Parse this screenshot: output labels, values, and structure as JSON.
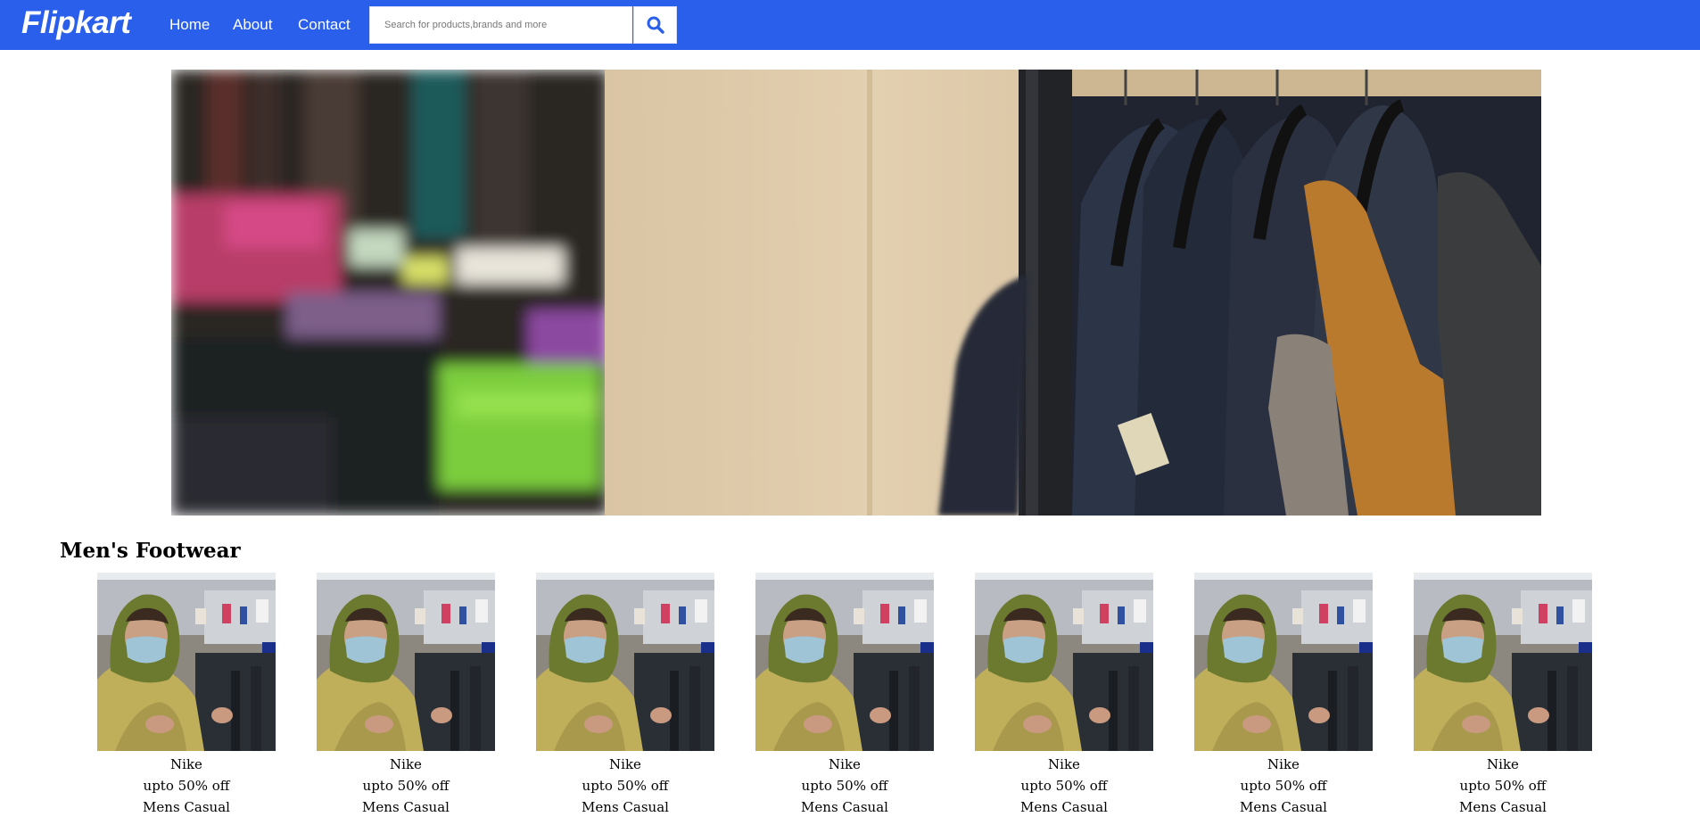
{
  "header": {
    "logo": "Flipkart",
    "nav": [
      {
        "label": "Home"
      },
      {
        "label": "About"
      },
      {
        "label": "Contact"
      }
    ],
    "search": {
      "placeholder": "Search for products,brands and more",
      "value": "",
      "button_icon": "search-icon"
    }
  },
  "colors": {
    "header_bg": "#2a5fec",
    "accent": "#2a5fec"
  },
  "banner": {
    "image": "clothing-rack-banner"
  },
  "section": {
    "title": "Men's Footwear"
  },
  "products": [
    {
      "brand": "Nike",
      "offer": "upto 50% off",
      "category": "Mens Casual",
      "image": "man-in-hoodie-photo"
    },
    {
      "brand": "Nike",
      "offer": "upto 50% off",
      "category": "Mens Casual",
      "image": "man-in-hoodie-photo"
    },
    {
      "brand": "Nike",
      "offer": "upto 50% off",
      "category": "Mens Casual",
      "image": "man-in-hoodie-photo"
    },
    {
      "brand": "Nike",
      "offer": "upto 50% off",
      "category": "Mens Casual",
      "image": "man-in-hoodie-photo"
    },
    {
      "brand": "Nike",
      "offer": "upto 50% off",
      "category": "Mens Casual",
      "image": "man-in-hoodie-photo"
    },
    {
      "brand": "Nike",
      "offer": "upto 50% off",
      "category": "Mens Casual",
      "image": "man-in-hoodie-photo"
    },
    {
      "brand": "Nike",
      "offer": "upto 50% off",
      "category": "Mens Casual",
      "image": "man-in-hoodie-photo"
    }
  ]
}
